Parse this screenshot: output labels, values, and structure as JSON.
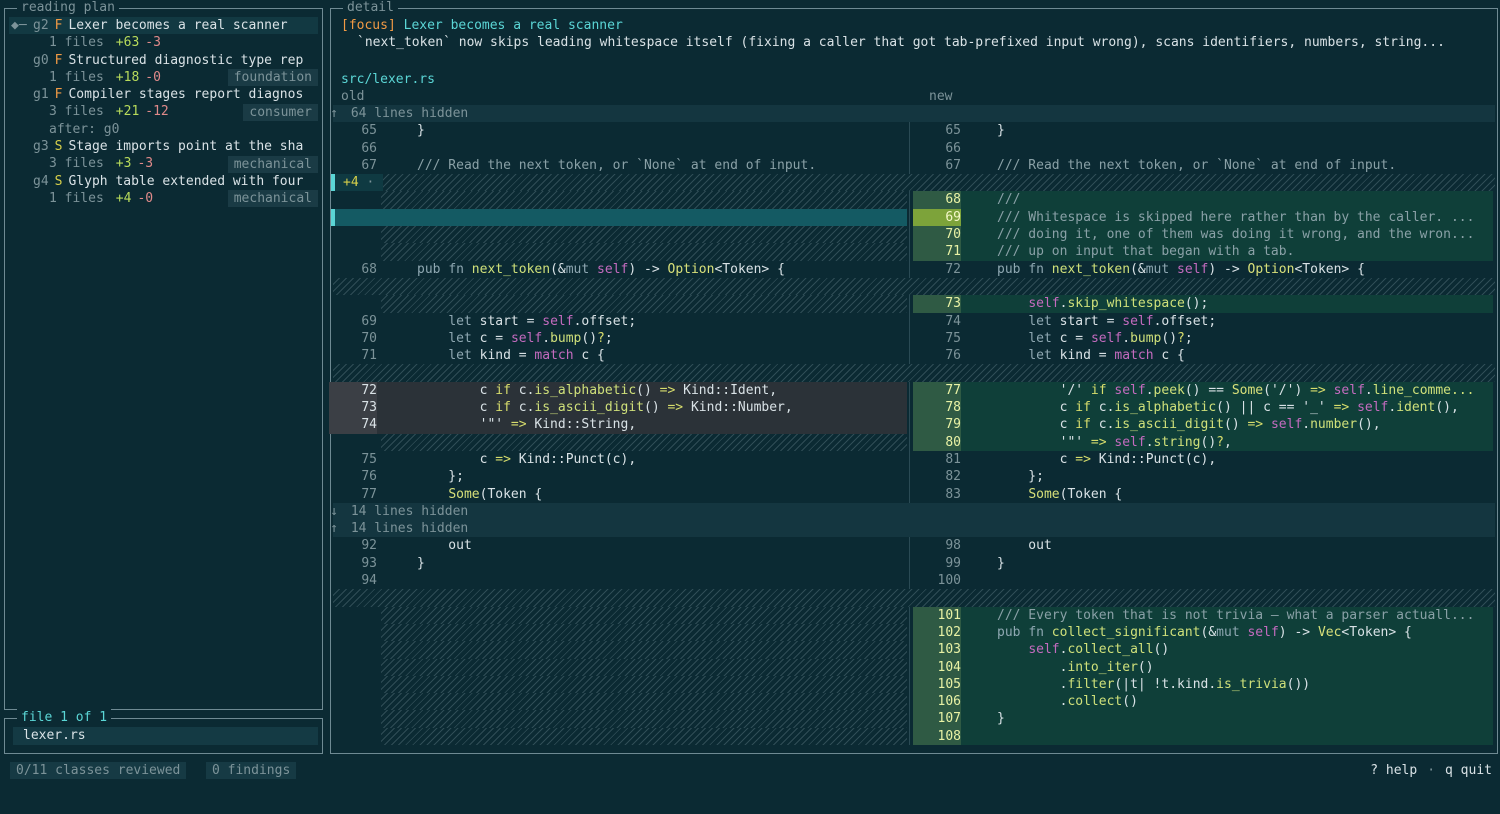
{
  "plan": {
    "title": "reading plan",
    "items": [
      {
        "caret": "◆─",
        "id": "g2",
        "kind": "F",
        "title": "Lexer becomes a real scanner",
        "files": "1 files",
        "add": "+63",
        "del": "-3",
        "tag": "",
        "after": ""
      },
      {
        "caret": "",
        "id": "g0",
        "kind": "F",
        "title": "Structured diagnostic type rep",
        "files": "1 files",
        "add": "+18",
        "del": "-0",
        "tag": "foundation",
        "after": ""
      },
      {
        "caret": "",
        "id": "g1",
        "kind": "F",
        "title": "Compiler stages report diagnos",
        "files": "3 files",
        "add": "+21",
        "del": "-12",
        "tag": "consumer",
        "after": "after: g0"
      },
      {
        "caret": "",
        "id": "g3",
        "kind": "S",
        "title": "Stage imports point at the sha",
        "files": "3 files",
        "add": "+3",
        "del": "-3",
        "tag": "mechanical",
        "after": ""
      },
      {
        "caret": "",
        "id": "g4",
        "kind": "S",
        "title": "Glyph table extended with four",
        "files": "1 files",
        "add": "+4",
        "del": "-0",
        "tag": "mechanical",
        "after": ""
      }
    ]
  },
  "files": {
    "title": "file 1 of 1",
    "name": "lexer.rs"
  },
  "detail": {
    "title": "detail",
    "focus_tag": "[focus]",
    "focus_title": "Lexer becomes a real scanner",
    "description": "`next_token` now skips leading whitespace itself (fixing a caller that got tab-prefixed input wrong), scans identifiers, numbers, string...",
    "file": "src/lexer.rs",
    "col_old": "old",
    "col_new": "new",
    "hidden_top": "64 lines hidden",
    "hunk_mark": "+4",
    "hunk_sep": " · ",
    "hunk_col": "C6",
    "hidden_mid_down": "14 lines hidden",
    "hidden_mid_up": "14 lines hidden"
  },
  "status": {
    "reviewed": "0/11 classes reviewed",
    "findings": "0 findings",
    "help": "? help",
    "sep": "·",
    "quit": "q quit"
  }
}
